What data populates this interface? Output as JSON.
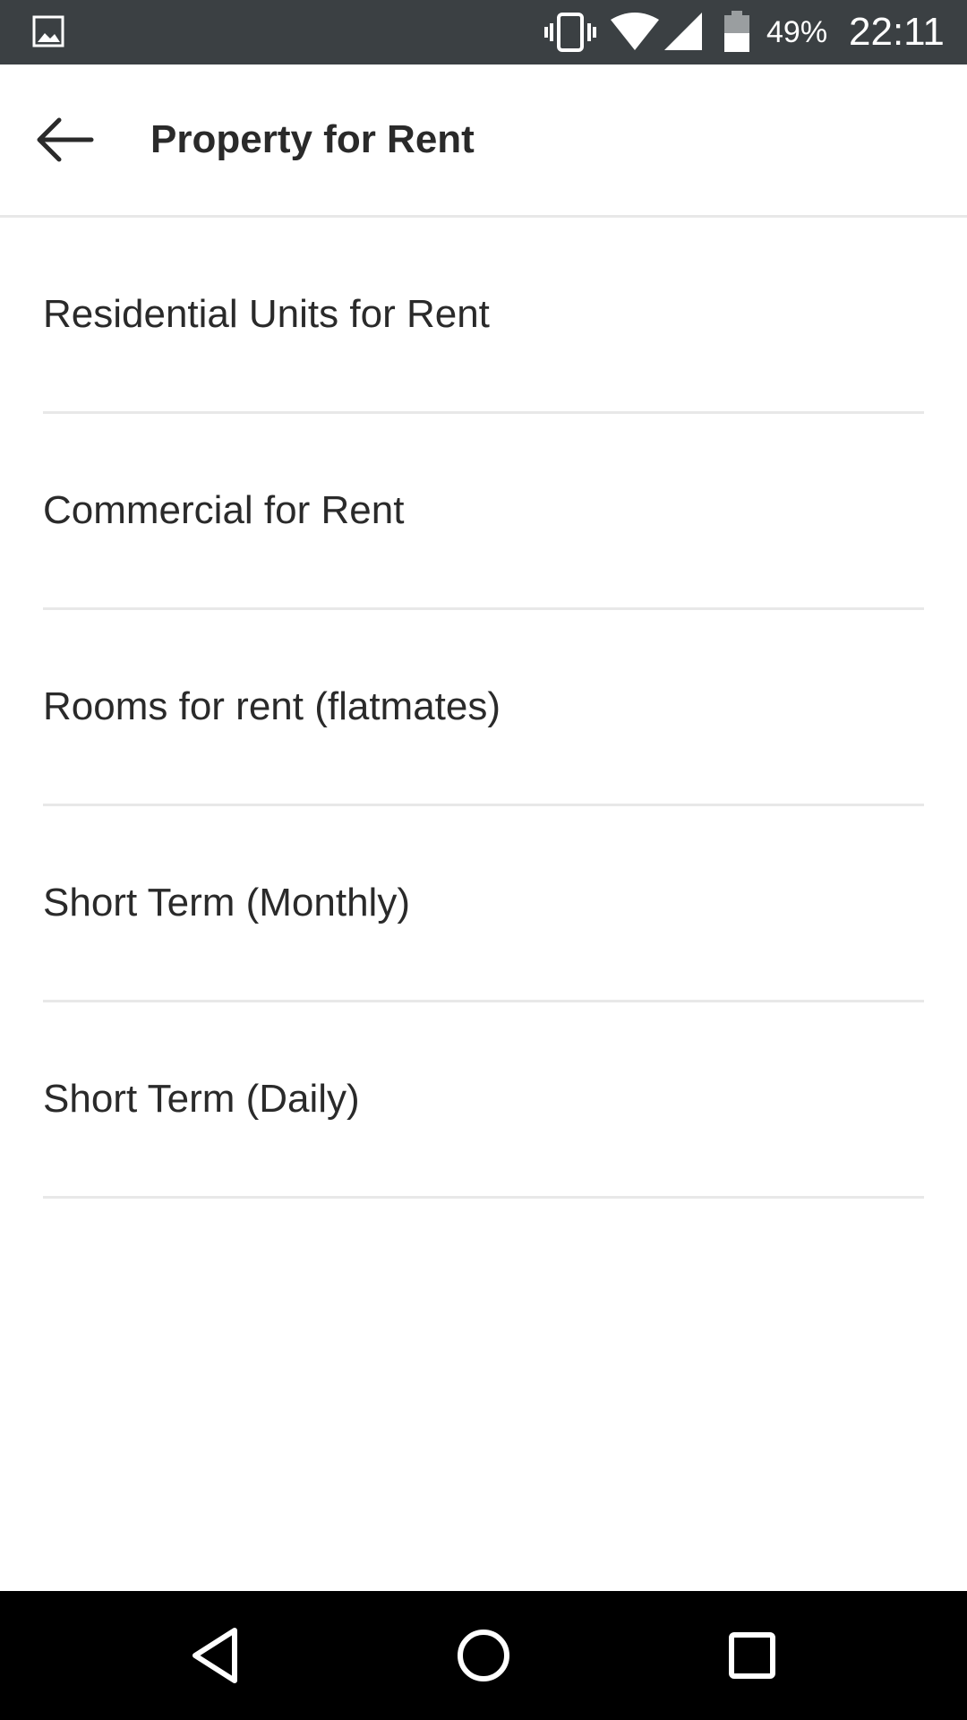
{
  "status_bar": {
    "battery_percent": "49%",
    "time": "22:11",
    "icons": [
      "gallery-icon",
      "vibrate-icon",
      "wifi-icon",
      "cellular-signal-icon",
      "battery-icon"
    ]
  },
  "app_bar": {
    "title": "Property for Rent",
    "back_icon": "arrow-back-icon"
  },
  "categories": [
    {
      "label": "Residential Units for Rent"
    },
    {
      "label": "Commercial for Rent"
    },
    {
      "label": "Rooms for rent (flatmates)"
    },
    {
      "label": "Short Term (Monthly)"
    },
    {
      "label": "Short Term (Daily)"
    }
  ],
  "nav_bar": {
    "icons": [
      "back-triangle-icon",
      "home-circle-icon",
      "recents-square-icon"
    ]
  },
  "colors": {
    "status_bar": "#3b4043",
    "text": "#2a2a2a",
    "divider": "#e8e8e8",
    "nav_bar": "#000000"
  }
}
